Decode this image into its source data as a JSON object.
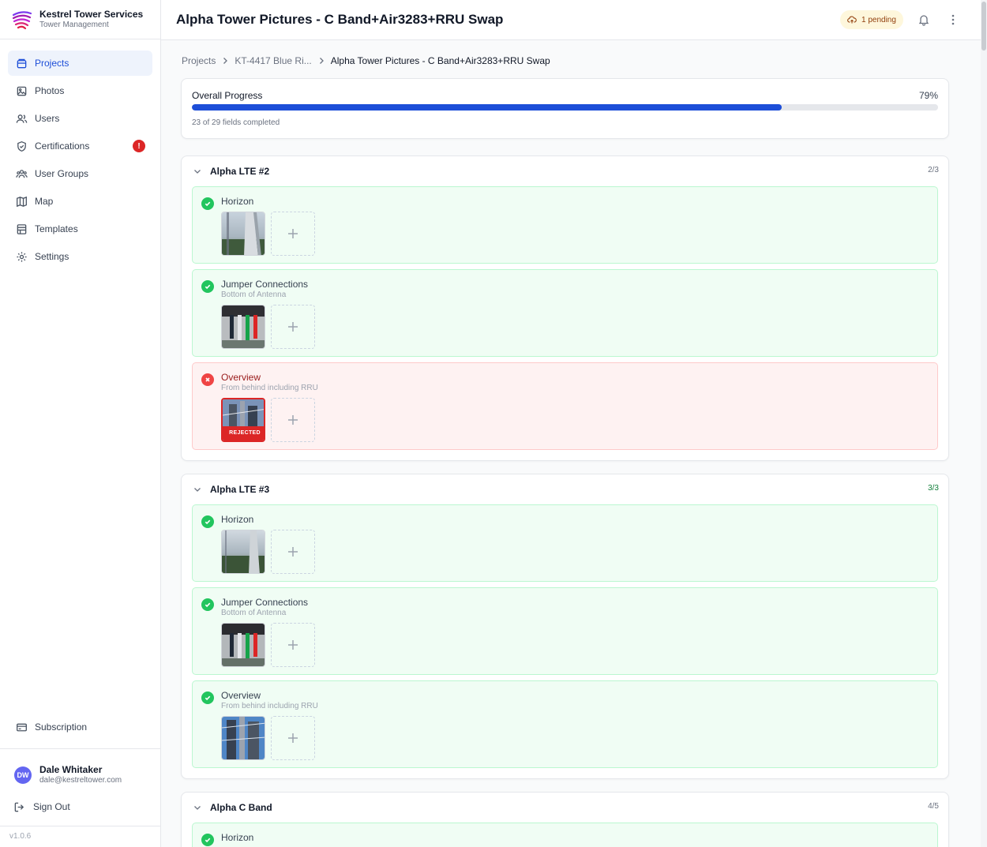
{
  "brand": {
    "name": "Kestrel Tower Services",
    "subtitle": "Tower Management"
  },
  "nav": [
    {
      "label": "Projects",
      "icon": "folder-icon",
      "active": true
    },
    {
      "label": "Photos",
      "icon": "image-icon"
    },
    {
      "label": "Users",
      "icon": "users-icon"
    },
    {
      "label": "Certifications",
      "icon": "shield-check-icon",
      "badge": "!"
    },
    {
      "label": "User Groups",
      "icon": "user-group-icon"
    },
    {
      "label": "Map",
      "icon": "map-icon"
    },
    {
      "label": "Templates",
      "icon": "template-icon"
    },
    {
      "label": "Settings",
      "icon": "gear-icon"
    }
  ],
  "subscription": {
    "label": "Subscription"
  },
  "user": {
    "initials": "DW",
    "name": "Dale Whitaker",
    "email": "dale@kestreltower.com"
  },
  "signout": {
    "label": "Sign Out"
  },
  "version": "v1.0.6",
  "header": {
    "title": "Alpha Tower Pictures - C Band+Air3283+RRU Swap",
    "pending": "1 pending"
  },
  "breadcrumb": {
    "root": "Projects",
    "project": "KT-4417 Blue Ri...",
    "current": "Alpha Tower Pictures - C Band+Air3283+RRU Swap"
  },
  "progress": {
    "label": "Overall Progress",
    "percent_text": "79%",
    "fraction": 0.79,
    "detail": "23 of 29 fields completed"
  },
  "sections": [
    {
      "title": "Alpha LTE #2",
      "count": "2/3",
      "fields": [
        {
          "title": "Horizon",
          "subtitle": "",
          "status": "ok"
        },
        {
          "title": "Jumper Connections",
          "subtitle": "Bottom of Antenna",
          "status": "ok"
        },
        {
          "title": "Overview",
          "subtitle": "From behind including RRU",
          "status": "rejected",
          "rejected_label": "REJECTED"
        }
      ]
    },
    {
      "title": "Alpha LTE #3",
      "count": "3/3",
      "fields": [
        {
          "title": "Horizon",
          "subtitle": "",
          "status": "ok"
        },
        {
          "title": "Jumper Connections",
          "subtitle": "Bottom of Antenna",
          "status": "ok"
        },
        {
          "title": "Overview",
          "subtitle": "From behind including RRU",
          "status": "ok"
        }
      ]
    },
    {
      "title": "Alpha C Band",
      "count": "4/5",
      "fields": [
        {
          "title": "Horizon",
          "subtitle": "",
          "status": "ok"
        }
      ]
    }
  ],
  "colors": {
    "accent": "#1d4ed8",
    "ok": "#22c55e",
    "rejected": "#dc2626",
    "pending_bg": "#fef7dc"
  }
}
